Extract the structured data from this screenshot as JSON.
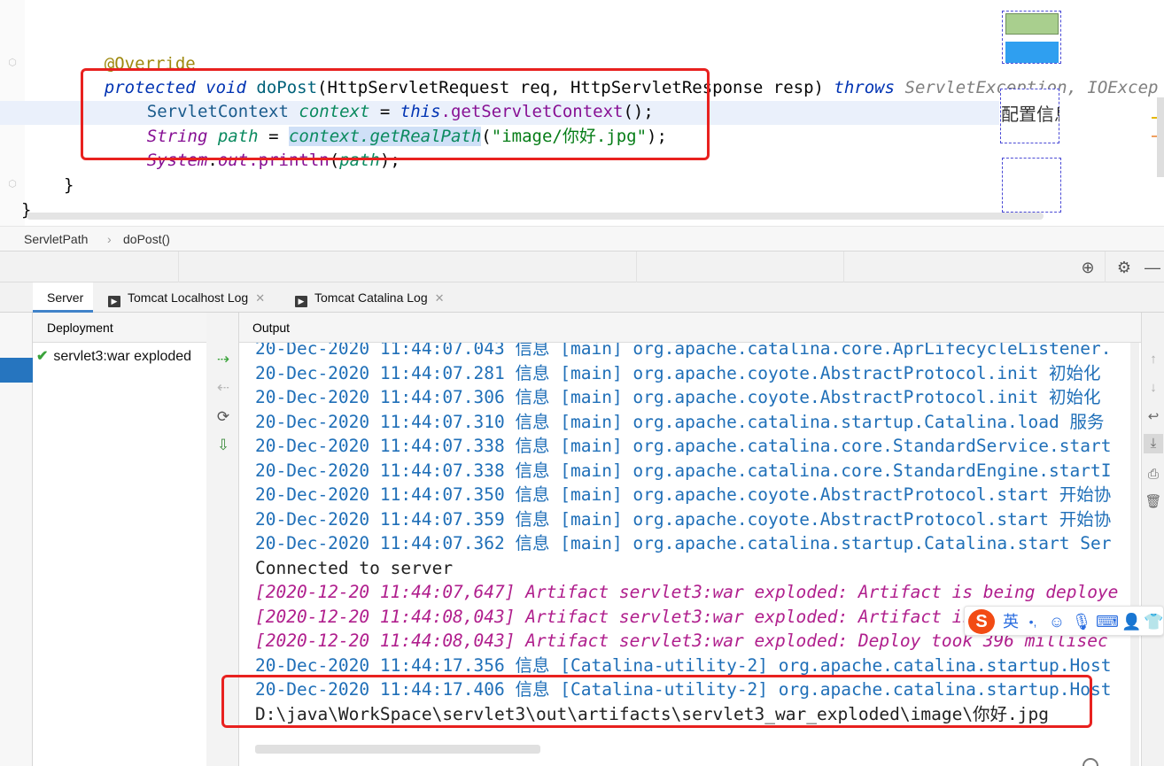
{
  "editor": {
    "annotation": "@Override",
    "signature": {
      "modifiers": "protected void",
      "method": "doPost",
      "params_a": "(HttpServletRequest req, HttpServletResponse resp)",
      "throws_kw": "throws",
      "exceptions": "ServletException, IOExcep"
    },
    "line1": {
      "type": "ServletContext",
      "var": "context",
      "eq": " = ",
      "kw": "this",
      "call": ".getServletContext",
      "tail": "();"
    },
    "line2": {
      "type": "String",
      "var": "path",
      "eq": " = ",
      "selected": "context.getRealPath",
      "open": "(",
      "str": "\"image/你好.jpg\"",
      "tail": ");"
    },
    "line3": {
      "cls": "System",
      "dot": ".",
      "field": "out",
      "call": ".println",
      "open": "(",
      "arg": "path",
      "tail": ");"
    },
    "close_inner": "}",
    "close_outer": "}",
    "side_text": "配置信息"
  },
  "breadcrumb": {
    "items": [
      "ServletPath",
      "doPost()"
    ],
    "sep": "›"
  },
  "tabs": [
    {
      "label": "Server",
      "active": true
    },
    {
      "label": "Tomcat Localhost Log",
      "active": false
    },
    {
      "label": "Tomcat Catalina Log",
      "active": false
    }
  ],
  "deployment": {
    "header": "Deployment",
    "items": [
      {
        "label": "servlet3:war exploded",
        "status": "deployed"
      }
    ]
  },
  "output": {
    "header": "Output",
    "lines": [
      {
        "style": "info",
        "text": "20-Dec-2020 11:44:07.043 信息 [main] org.apache.catalina.core.AprLifecycleListener."
      },
      {
        "style": "info",
        "text": "20-Dec-2020 11:44:07.281 信息 [main] org.apache.coyote.AbstractProtocol.init 初始化"
      },
      {
        "style": "info",
        "text": "20-Dec-2020 11:44:07.306 信息 [main] org.apache.coyote.AbstractProtocol.init 初始化"
      },
      {
        "style": "info",
        "text": "20-Dec-2020 11:44:07.310 信息 [main] org.apache.catalina.startup.Catalina.load 服务"
      },
      {
        "style": "info",
        "text": "20-Dec-2020 11:44:07.338 信息 [main] org.apache.catalina.core.StandardService.start"
      },
      {
        "style": "info",
        "text": "20-Dec-2020 11:44:07.338 信息 [main] org.apache.catalina.core.StandardEngine.startI"
      },
      {
        "style": "info",
        "text": "20-Dec-2020 11:44:07.350 信息 [main] org.apache.coyote.AbstractProtocol.start 开始协"
      },
      {
        "style": "info",
        "text": "20-Dec-2020 11:44:07.359 信息 [main] org.apache.coyote.AbstractProtocol.start 开始协"
      },
      {
        "style": "info",
        "text": "20-Dec-2020 11:44:07.362 信息 [main] org.apache.catalina.startup.Catalina.start Ser"
      },
      {
        "style": "plain",
        "text": "Connected to server"
      },
      {
        "style": "art",
        "text": "[2020-12-20 11:44:07,647] Artifact servlet3:war exploded: Artifact is being deploye"
      },
      {
        "style": "art",
        "text": "[2020-12-20 11:44:08,043] Artifact servlet3:war exploded: Artifact is deployed succ"
      },
      {
        "style": "art",
        "text": "[2020-12-20 11:44:08,043] Artifact servlet3:war exploded: Deploy took 396 millisec"
      },
      {
        "style": "info",
        "text": "20-Dec-2020 11:44:17.356 信息 [Catalina-utility-2] org.apache.catalina.startup.Host"
      },
      {
        "style": "info",
        "text": "20-Dec-2020 11:44:17.406 信息 [Catalina-utility-2] org.apache.catalina.startup.Host"
      },
      {
        "style": "plain",
        "text": "D:\\java\\WorkSpace\\servlet3\\out\\artifacts\\servlet3_war_exploded\\image\\你好.jpg"
      }
    ]
  },
  "ime": {
    "logo": "S",
    "lang": "英",
    "punct": "•,",
    "icons": [
      "emoji-icon",
      "mic-icon",
      "keyboard-icon",
      "user-icon",
      "shirt-icon"
    ]
  },
  "colors": {
    "highlight_box": "#e8211f",
    "info_text": "#1f6fb8",
    "artifact_text": "#b01f8d",
    "selection": "#2675bf"
  }
}
